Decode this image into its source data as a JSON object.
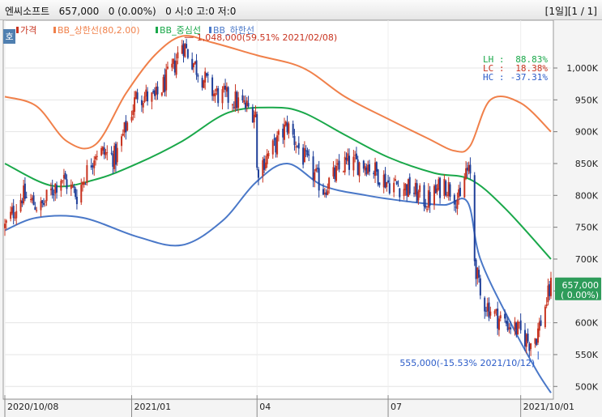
{
  "header": {
    "stock_name": "엔씨소프트",
    "price": "657,000",
    "change": "0 (0.00%)",
    "volume": "0",
    "ohlc": "시:0 고:0 저:0",
    "period": "[1일]",
    "page": "[1 / 1]"
  },
  "chart_data": {
    "type": "candlestick",
    "tab_label": "호",
    "legend": [
      "가격",
      "BB_상한선(80,2.00)",
      "BB_중심선",
      "BB_하한선"
    ],
    "colors": {
      "up": "#c8331f",
      "down": "#1f3f99",
      "upper": "#f0804a",
      "middle": "#1aa84a",
      "lower": "#4a78c8"
    },
    "ylim": [
      480000,
      1075000
    ],
    "yticks": [
      {
        "value": 500000,
        "label": "500K"
      },
      {
        "value": 550000,
        "label": "550K"
      },
      {
        "value": 600000,
        "label": "600K"
      },
      {
        "value": 650000,
        "label": "650K"
      },
      {
        "value": 700000,
        "label": "700K"
      },
      {
        "value": 750000,
        "label": "750K"
      },
      {
        "value": 800000,
        "label": "800K"
      },
      {
        "value": 850000,
        "label": "850K"
      },
      {
        "value": 900000,
        "label": "900K"
      },
      {
        "value": 950000,
        "label": "950K"
      },
      {
        "value": 1000000,
        "label": "1,000K"
      }
    ],
    "xticks": [
      {
        "date": "2020-10-08",
        "label": "2020/10/08"
      },
      {
        "date": "2021-01-04",
        "label": "2021/01"
      },
      {
        "date": "2021-04-01",
        "label": "04"
      },
      {
        "date": "2021-07-01",
        "label": "07"
      },
      {
        "date": "2021-10-01",
        "label": "2021/10/01"
      }
    ],
    "start_date": "2020-10-08",
    "end_date": "2021-10-22",
    "price_path": [
      [
        "2020-10-08",
        750000
      ],
      [
        "2020-10-20",
        800000
      ],
      [
        "2020-11-02",
        780000
      ],
      [
        "2020-11-16",
        830000
      ],
      [
        "2020-11-27",
        800000
      ],
      [
        "2020-12-10",
        870000
      ],
      [
        "2020-12-24",
        860000
      ],
      [
        "2021-01-08",
        960000
      ],
      [
        "2021-01-20",
        950000
      ],
      [
        "2021-02-02",
        1000000
      ],
      [
        "2021-02-08",
        1040000
      ],
      [
        "2021-02-18",
        1000000
      ],
      [
        "2021-03-02",
        960000
      ],
      [
        "2021-03-16",
        950000
      ],
      [
        "2021-03-31",
        930000
      ],
      [
        "2021-04-01",
        840000
      ],
      [
        "2021-04-14",
        880000
      ],
      [
        "2021-04-22",
        910000
      ],
      [
        "2021-05-03",
        860000
      ],
      [
        "2021-05-17",
        810000
      ],
      [
        "2021-06-01",
        850000
      ],
      [
        "2021-06-16",
        850000
      ],
      [
        "2021-07-01",
        820000
      ],
      [
        "2021-07-16",
        810000
      ],
      [
        "2021-07-28",
        790000
      ],
      [
        "2021-08-09",
        820000
      ],
      [
        "2021-08-20",
        790000
      ],
      [
        "2021-08-24",
        840000
      ],
      [
        "2021-08-27",
        830000
      ],
      [
        "2021-08-30",
        700000
      ],
      [
        "2021-09-03",
        640000
      ],
      [
        "2021-09-14",
        610000
      ],
      [
        "2021-09-28",
        590000
      ],
      [
        "2021-10-07",
        570000
      ],
      [
        "2021-10-12",
        580000
      ],
      [
        "2021-10-22",
        657000
      ]
    ],
    "bb_upper": [
      [
        "2020-10-08",
        955000
      ],
      [
        "2020-10-30",
        940000
      ],
      [
        "2020-11-20",
        885000
      ],
      [
        "2020-12-10",
        880000
      ],
      [
        "2020-12-31",
        960000
      ],
      [
        "2021-01-20",
        1020000
      ],
      [
        "2021-02-08",
        1050000
      ],
      [
        "2021-03-01",
        1040000
      ],
      [
        "2021-04-01",
        1020000
      ],
      [
        "2021-05-03",
        1000000
      ],
      [
        "2021-06-01",
        955000
      ],
      [
        "2021-07-01",
        920000
      ],
      [
        "2021-07-28",
        890000
      ],
      [
        "2021-08-16",
        870000
      ],
      [
        "2021-08-27",
        878000
      ],
      [
        "2021-09-10",
        950000
      ],
      [
        "2021-10-01",
        945000
      ],
      [
        "2021-10-22",
        900000
      ]
    ],
    "bb_middle": [
      [
        "2020-10-08",
        850000
      ],
      [
        "2020-11-10",
        815000
      ],
      [
        "2020-12-10",
        825000
      ],
      [
        "2021-01-08",
        850000
      ],
      [
        "2021-02-08",
        885000
      ],
      [
        "2021-03-12",
        930000
      ],
      [
        "2021-04-12",
        938000
      ],
      [
        "2021-05-03",
        930000
      ],
      [
        "2021-06-01",
        895000
      ],
      [
        "2021-07-01",
        860000
      ],
      [
        "2021-08-02",
        835000
      ],
      [
        "2021-08-27",
        825000
      ],
      [
        "2021-09-20",
        780000
      ],
      [
        "2021-10-22",
        700000
      ]
    ],
    "bb_lower": [
      [
        "2020-10-08",
        745000
      ],
      [
        "2020-10-30",
        765000
      ],
      [
        "2020-12-01",
        765000
      ],
      [
        "2021-01-08",
        735000
      ],
      [
        "2021-02-08",
        722000
      ],
      [
        "2021-03-08",
        760000
      ],
      [
        "2021-03-31",
        820000
      ],
      [
        "2021-04-22",
        850000
      ],
      [
        "2021-05-17",
        815000
      ],
      [
        "2021-06-16",
        800000
      ],
      [
        "2021-07-16",
        790000
      ],
      [
        "2021-08-09",
        785000
      ],
      [
        "2021-08-25",
        790000
      ],
      [
        "2021-09-03",
        700000
      ],
      [
        "2021-09-24",
        600000
      ],
      [
        "2021-10-12",
        525000
      ],
      [
        "2021-10-22",
        490000
      ]
    ],
    "annotations": [
      {
        "text": "1,048,000(59.51% 2021/02/08)",
        "date": "2021-02-08",
        "value": 1048000
      },
      {
        "text": "555,000(-15.53% 2021/10/12)",
        "date": "2021-10-12",
        "value": 555000
      }
    ],
    "stats": [
      {
        "label": "LH",
        "value": "88.83%",
        "color": "#1aa84a"
      },
      {
        "label": "LC",
        "value": "18.38%",
        "color": "#c8331f"
      },
      {
        "label": "HC",
        "value": "-37.31%",
        "color": "#2a5bc8"
      }
    ],
    "current": {
      "value": 657000,
      "price_label": "657,000",
      "change_label": "( 0.00%)"
    }
  }
}
